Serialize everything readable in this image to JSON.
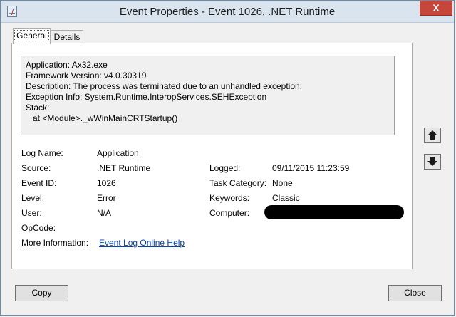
{
  "window": {
    "title": "Event Properties - Event 1026, .NET Runtime",
    "close_label": "X"
  },
  "tabs": [
    {
      "label": "General",
      "active": true
    },
    {
      "label": "Details",
      "active": false
    }
  ],
  "description": "Application: Ax32.exe\nFramework Version: v4.0.30319\nDescription: The process was terminated due to an unhandled exception.\nException Info: System.Runtime.InteropServices.SEHException\nStack:\n   at <Module>._wWinMainCRTStartup()",
  "fields": {
    "log_name": {
      "label": "Log Name:",
      "value": "Application"
    },
    "source": {
      "label": "Source:",
      "value": ".NET Runtime"
    },
    "event_id": {
      "label": "Event ID:",
      "value": "1026"
    },
    "level": {
      "label": "Level:",
      "value": "Error"
    },
    "user": {
      "label": "User:",
      "value": "N/A"
    },
    "opcode": {
      "label": "OpCode:",
      "value": ""
    },
    "more_info": {
      "label": "More Information:",
      "value": "Event Log Online Help"
    },
    "logged": {
      "label": "Logged:",
      "value": "09/11/2015 11:23:59"
    },
    "task_category": {
      "label": "Task Category:",
      "value": "None"
    },
    "keywords": {
      "label": "Keywords:",
      "value": "Classic"
    },
    "computer": {
      "label": "Computer:",
      "value": ""
    }
  },
  "nav": {
    "up_icon": "arrow-up-icon",
    "down_icon": "arrow-down-icon"
  },
  "buttons": {
    "copy": "Copy",
    "close": "Close"
  }
}
